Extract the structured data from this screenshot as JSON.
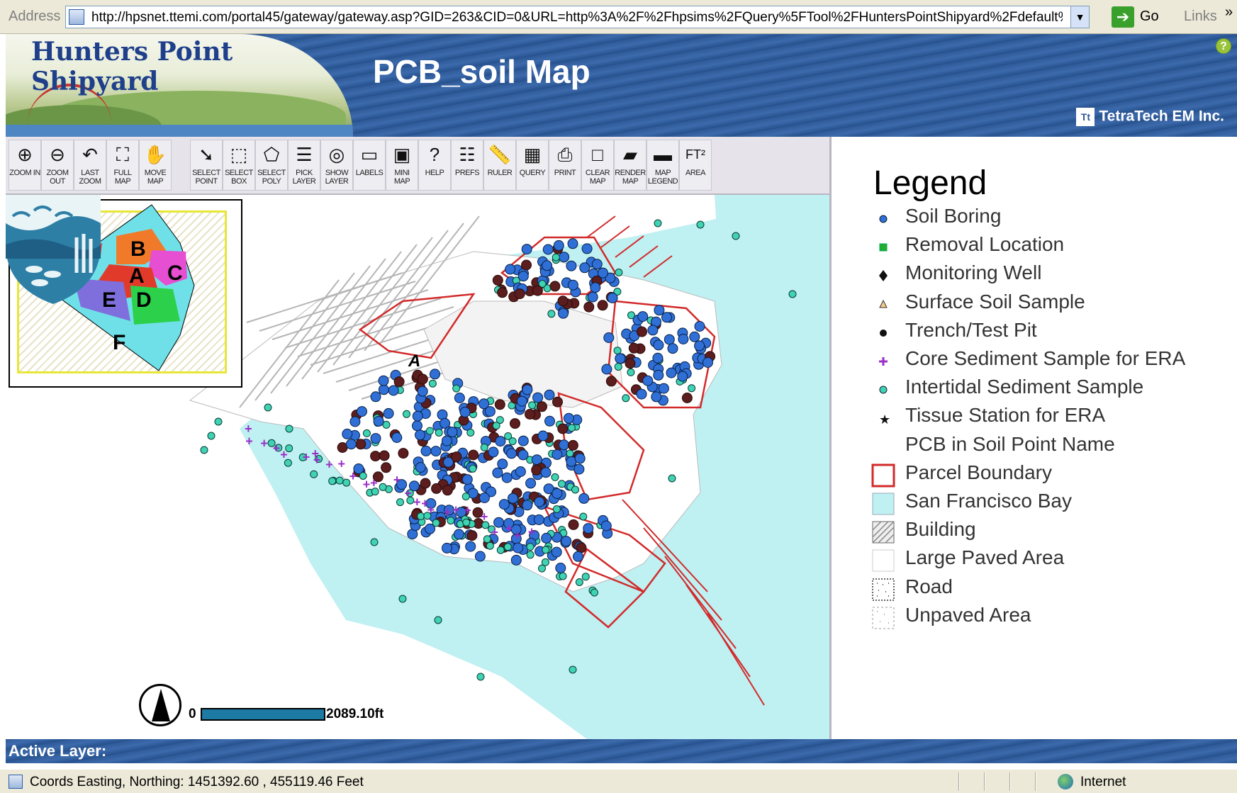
{
  "browser": {
    "address_label": "Address",
    "url": "http://hpsnet.ttemi.com/portal45/gateway/gateway.asp?GID=263&CID=0&URL=http%3A%2F%2Fhpsims%2FQuery%5FTool%2FHuntersPointShipyard%2Fdefault%2",
    "go_label": "Go",
    "links_label": "Links",
    "more_label": "»"
  },
  "header": {
    "site_name": "Hunters Point Shipyard",
    "map_title": "PCB_soil Map",
    "company": "TetraTech EM Inc.",
    "company_logo_text": "Tt",
    "help_label": "?"
  },
  "toolbar": {
    "buttons": [
      {
        "label": "ZOOM IN",
        "icon": "zoom-in-icon",
        "glyph": "⊕"
      },
      {
        "label": "ZOOM OUT",
        "icon": "zoom-out-icon",
        "glyph": "⊖"
      },
      {
        "label": "LAST ZOOM",
        "icon": "undo-icon",
        "glyph": "↶"
      },
      {
        "label": "FULL MAP",
        "icon": "full-extent-icon",
        "glyph": "⛶"
      },
      {
        "label": "MOVE MAP",
        "icon": "hand-icon",
        "glyph": "✋"
      },
      {
        "label": "SELECT POINT",
        "icon": "select-point-icon",
        "glyph": "➘"
      },
      {
        "label": "SELECT BOX",
        "icon": "select-box-icon",
        "glyph": "⬚"
      },
      {
        "label": "SELECT POLY",
        "icon": "select-poly-icon",
        "glyph": "⬠"
      },
      {
        "label": "PICK LAYER",
        "icon": "pick-layer-icon",
        "glyph": "☰"
      },
      {
        "label": "SHOW LAYER",
        "icon": "show-layer-icon",
        "glyph": "◎"
      },
      {
        "label": "LABELS",
        "icon": "labels-icon",
        "glyph": "▭"
      },
      {
        "label": "MINI MAP",
        "icon": "mini-map-icon",
        "glyph": "▣"
      },
      {
        "label": "HELP",
        "icon": "help-icon",
        "glyph": "?"
      },
      {
        "label": "PREFS",
        "icon": "prefs-icon",
        "glyph": "☷"
      },
      {
        "label": "RULER",
        "icon": "ruler-icon",
        "glyph": "📏"
      },
      {
        "label": "QUERY",
        "icon": "query-icon",
        "glyph": "▦"
      },
      {
        "label": "PRINT",
        "icon": "print-icon",
        "glyph": "⎙"
      },
      {
        "label": "CLEAR MAP",
        "icon": "clear-map-icon",
        "glyph": "□"
      },
      {
        "label": "RENDER MAP",
        "icon": "render-map-icon",
        "glyph": "▰"
      },
      {
        "label": "MAP LEGEND",
        "icon": "map-legend-icon",
        "glyph": "▬"
      },
      {
        "label": "AREA",
        "icon": "area-icon",
        "glyph": "FT²"
      }
    ]
  },
  "map": {
    "parcel_label": "A",
    "overview_parcels": [
      "B",
      "A",
      "C",
      "E",
      "D",
      "F"
    ],
    "scale_start": "0",
    "scale_end": "2089.10ft"
  },
  "legend": {
    "title": "Legend",
    "items": [
      {
        "label": "Soil Boring",
        "symbol": "blue-dot"
      },
      {
        "label": "Removal Location",
        "symbol": "green-square"
      },
      {
        "label": "Monitoring Well",
        "symbol": "black-diamond"
      },
      {
        "label": "Surface Soil Sample",
        "symbol": "triangle"
      },
      {
        "label": "Trench/Test Pit",
        "symbol": "black-dot"
      },
      {
        "label": "Core Sediment Sample for ERA",
        "symbol": "purple-plus"
      },
      {
        "label": "Intertidal Sediment Sample",
        "symbol": "teal-hexagon"
      },
      {
        "label": "Tissue Station for ERA",
        "symbol": "black-star"
      },
      {
        "label": "PCB in Soil Point Name",
        "symbol": "none"
      },
      {
        "label": "Parcel Boundary",
        "symbol": "red-box"
      },
      {
        "label": "San Francisco Bay",
        "symbol": "cyan-box"
      },
      {
        "label": "Building",
        "symbol": "hatched-box"
      },
      {
        "label": "Large Paved Area",
        "symbol": "white-box"
      },
      {
        "label": "Road",
        "symbol": "dotted-box"
      },
      {
        "label": "Unpaved Area",
        "symbol": "dotted-light-box"
      }
    ],
    "colors": {
      "parcel": "#d22a2a",
      "bay": "#bff0f2",
      "boring": "#2f6fd6",
      "intertidal": "#3fd3b4",
      "core": "#9a2fc8"
    }
  },
  "active_layer": {
    "label": "Active Layer:"
  },
  "status": {
    "coords": "Coords Easting, Northing: 1451392.60 , 455119.46 Feet",
    "zone": "Internet"
  }
}
